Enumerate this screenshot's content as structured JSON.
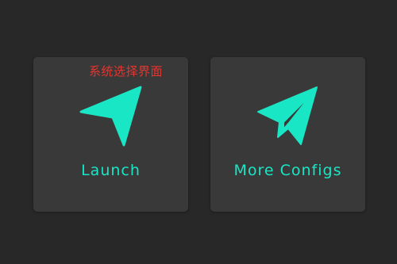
{
  "caption": "系统选择界面",
  "cards": [
    {
      "label": "Launch",
      "icon": "navigation-arrow-icon"
    },
    {
      "label": "More Configs",
      "icon": "paper-plane-icon"
    }
  ],
  "colors": {
    "background": "#282828",
    "card": "#393939",
    "accent": "#19e6c4",
    "caption": "#e8342e"
  }
}
